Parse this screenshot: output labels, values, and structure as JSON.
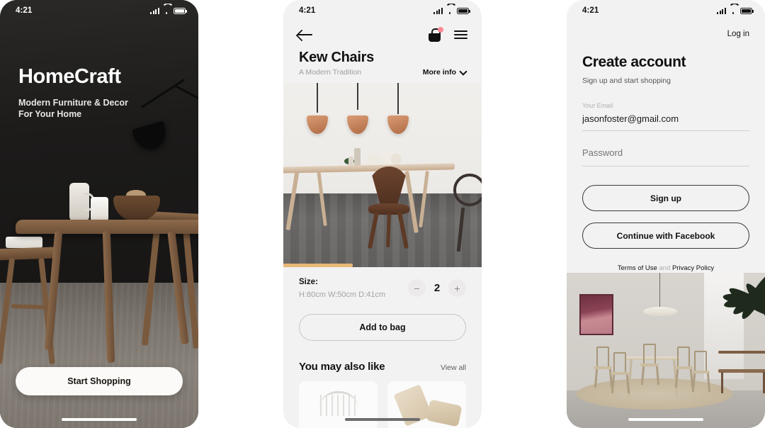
{
  "screens": [
    {
      "id": "onboarding",
      "status_bar": {
        "time": "4:21",
        "signal_icon": "cellular-bars-icon",
        "wifi_icon": "wifi-icon",
        "battery_icon": "battery-icon"
      },
      "brand_title": "HomeCraft",
      "tagline_line1": "Modern Furniture & Decor",
      "tagline_line2": "For Your Home",
      "cta_label": "Start Shopping"
    },
    {
      "id": "product-detail",
      "status_bar": {
        "time": "4:21"
      },
      "nav": {
        "back_icon": "arrow-left-icon",
        "cart_icon": "shopping-bag-icon",
        "cart_badge_color": "#ff8a93",
        "menu_icon": "hamburger-menu-icon"
      },
      "product_title": "Kew Chairs",
      "product_subtitle": "A Modern Tradition",
      "more_info_label": "More info",
      "gallery_progress_percent": 35,
      "progress_color": "#e8b877",
      "size_label": "Size:",
      "size_value": "H:80cm W:50cm D:41cm",
      "quantity": "2",
      "decrement_label": "−",
      "increment_label": "+",
      "add_to_bag_label": "Add to bag",
      "also_like_title": "You may also like",
      "view_all_label": "View all"
    },
    {
      "id": "create-account",
      "status_bar": {
        "time": "4:21"
      },
      "login_label": "Log in",
      "title": "Create account",
      "subtitle": "Sign up and start shopping",
      "email_field": {
        "label": "Your Email",
        "value": "jasonfoster@gmail.com",
        "placeholder": "Your Email"
      },
      "password_field": {
        "label": "Password",
        "value": "",
        "placeholder": "Password"
      },
      "signup_label": "Sign up",
      "facebook_label": "Continue with Facebook",
      "legal": {
        "terms": "Terms of Use",
        "and": "and",
        "privacy": "Privacy Policy"
      }
    }
  ],
  "theme": {
    "page_background": "#ffffff",
    "dark_screen_bg": "#1d1d1d",
    "light_screen_bg": "#f2f2f2",
    "accent": "#e8b877"
  }
}
